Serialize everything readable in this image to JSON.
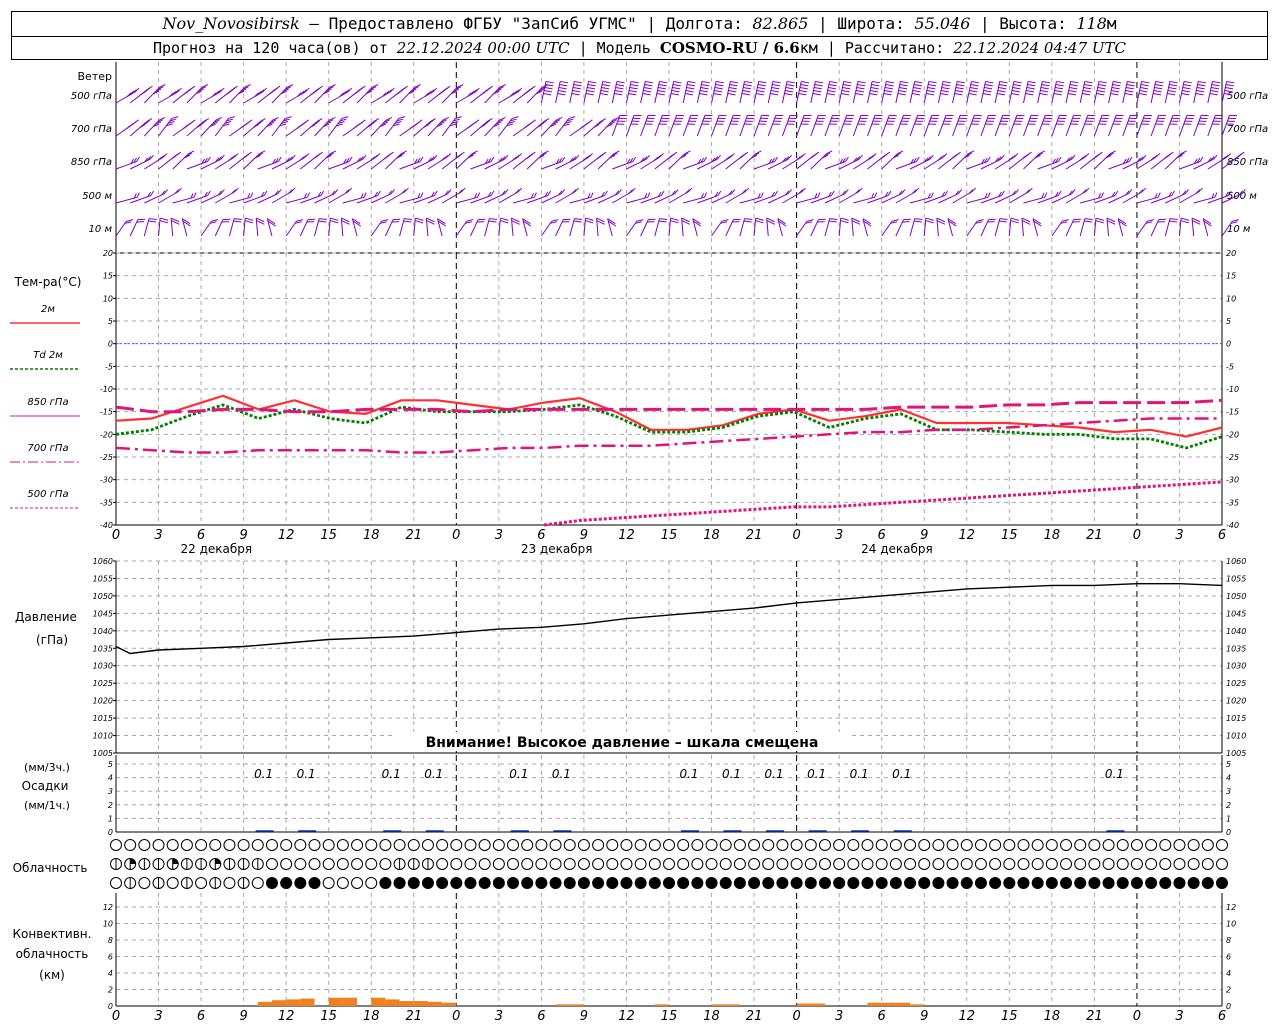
{
  "header": {
    "station": "Nov_Novosibirsk",
    "provided": "– Предоставлено ФГБУ \"ЗапСиб УГМС\" | Долгота:",
    "lon": "82.865",
    "lat_label": "| Широта:",
    "lat": "55.046",
    "alt_label": "| Высота:",
    "alt": "118",
    "alt_unit": "м",
    "forecast_label": "Прогноз на 120 часа(ов) от",
    "forecast_time": "22.12.2024 00:00 UTC",
    "model_label": "| Модель",
    "model": "COSMO-RU / 6.6",
    "model_unit": "км",
    "computed_label": "| Рассчитано:",
    "computed_time": "22.12.2024 04:47 UTC"
  },
  "wind": {
    "title": "Ветер",
    "levels": [
      "500 гПа",
      "700 гПа",
      "850 гПа",
      "500 м",
      "10 м"
    ],
    "color": "#8000c0"
  },
  "temperature": {
    "title": "Тем-ра(°C)",
    "legend": [
      {
        "label": "2м",
        "color": "#ff3030"
      },
      {
        "label": "Td 2м",
        "color": "#008000"
      },
      {
        "label": "850 гПа",
        "color": "#e0147c"
      },
      {
        "label": "700 гПа",
        "color": "#e0147c"
      },
      {
        "label": "500 гПа",
        "color": "#e0147c"
      }
    ],
    "ticks": [
      "20",
      "15",
      "10",
      "5",
      "0",
      "-5",
      "-10",
      "-15",
      "-20",
      "-25",
      "-30",
      "-35",
      "-40"
    ]
  },
  "time_axis": {
    "hour_labels": [
      "0",
      "3",
      "6",
      "9",
      "12",
      "15",
      "18",
      "21",
      "0",
      "3",
      "6",
      "9",
      "12",
      "15",
      "18",
      "21",
      "0",
      "3",
      "6",
      "9",
      "12",
      "15",
      "18",
      "21",
      "0",
      "3",
      "6"
    ],
    "day_labels": [
      "22 декабря",
      "23 декабря",
      "24 декабря"
    ]
  },
  "pressure": {
    "title": "Давление",
    "unit": "(гПа)",
    "ticks": [
      "1060",
      "1055",
      "1050",
      "1045",
      "1040",
      "1035",
      "1030",
      "1025",
      "1020",
      "1015",
      "1010",
      "1005"
    ],
    "warning": "Внимание! Высокое давление – шкала смещена"
  },
  "precip": {
    "label_3h": "(мм/3ч.)",
    "title": "Осадки",
    "label_1h": "(мм/1ч.)",
    "ticks": [
      "5",
      "4",
      "3",
      "2",
      "1",
      "0"
    ],
    "value_labels": [
      {
        "hour": 9,
        "text": "0.1"
      },
      {
        "hour": 12,
        "text": "0.1"
      },
      {
        "hour": 18,
        "text": "0.1"
      },
      {
        "hour": 21,
        "text": "0.1"
      },
      {
        "hour": 27,
        "text": "0.1"
      },
      {
        "hour": 30,
        "text": "0.1"
      },
      {
        "hour": 39,
        "text": "0.1"
      },
      {
        "hour": 42,
        "text": "0.1"
      },
      {
        "hour": 45,
        "text": "0.1"
      },
      {
        "hour": 48,
        "text": "0.1"
      },
      {
        "hour": 51,
        "text": "0.1"
      },
      {
        "hour": 54,
        "text": "0.1"
      },
      {
        "hour": 69,
        "text": "0.1"
      }
    ]
  },
  "cloud": {
    "title": "Облачность"
  },
  "convective": {
    "title_1": "Конвективн.",
    "title_2": "облачность",
    "unit": "(км)",
    "ticks": [
      "12",
      "10",
      "8",
      "6",
      "4",
      "2",
      "0"
    ],
    "color": "#f08020"
  },
  "chart_data": [
    {
      "type": "line",
      "title": "Тем-ра(°C)",
      "ylim": [
        -40,
        20
      ],
      "x_hours": [
        0,
        3,
        6,
        9,
        12,
        15,
        18,
        21,
        24,
        27,
        30,
        33,
        36,
        39,
        42,
        45,
        48,
        51,
        54,
        57,
        60,
        63,
        66,
        69,
        72,
        75,
        78
      ],
      "series": [
        {
          "name": "2м",
          "values": [
            -17,
            -16.5,
            -14,
            -11.5,
            -14.5,
            -12.5,
            -15,
            -15.5,
            -12.5,
            -12.5,
            -13.5,
            -14.5,
            -13,
            -12,
            -15,
            -19,
            -19,
            -18,
            -15.5,
            -14.5,
            -17,
            -16,
            -14.5,
            -17.5,
            -17.5,
            -17.5,
            -18,
            -18.5,
            -19.5,
            -19,
            -20.5,
            -18.5
          ]
        },
        {
          "name": "Td 2м",
          "values": [
            -20,
            -19,
            -16,
            -13.5,
            -16.5,
            -14.5,
            -16.5,
            -17.5,
            -14,
            -15,
            -15,
            -15,
            -14.5,
            -13.5,
            -16,
            -19.5,
            -19.5,
            -18.5,
            -16,
            -15,
            -18.5,
            -16.5,
            -15.5,
            -19,
            -19,
            -19.5,
            -20,
            -20,
            -21,
            -21,
            -23,
            -20.5
          ]
        },
        {
          "name": "850 гПа",
          "values": [
            -14,
            -15,
            -15,
            -14.5,
            -14.5,
            -15,
            -15,
            -14.5,
            -14.5,
            -14.5,
            -15,
            -14.5,
            -14.5,
            -14.5,
            -14.5,
            -14.5,
            -14.5,
            -14.5,
            -14.5,
            -14.5,
            -14.5,
            -14.5,
            -14,
            -14,
            -14,
            -13.5,
            -13.5,
            -13,
            -13,
            -13,
            -13,
            -12.5
          ]
        },
        {
          "name": "700 гПа",
          "values": [
            -23,
            -23.5,
            -24,
            -24,
            -23.5,
            -23.5,
            -23.5,
            -23.5,
            -24,
            -24,
            -23.5,
            -23,
            -23,
            -22.5,
            -22.5,
            -22.5,
            -22,
            -21.5,
            -21,
            -20.5,
            -20,
            -19.5,
            -19.5,
            -19,
            -19,
            -18.5,
            -18,
            -17.5,
            -17,
            -16.5,
            -16.5,
            -16.5
          ]
        },
        {
          "name": "500 гПа",
          "values": [
            null,
            null,
            null,
            null,
            null,
            null,
            null,
            null,
            null,
            null,
            null,
            null,
            -40,
            -39,
            -38.5,
            -38,
            -37.5,
            -37,
            -36.5,
            -36,
            -36,
            -35.5,
            -35,
            -34.5,
            -34,
            -33.5,
            -33,
            -32.5,
            -32,
            -31.5,
            -31,
            -30.5
          ]
        }
      ],
      "series_x_hours": [
        0,
        3,
        6,
        9,
        12,
        15,
        18,
        21,
        24,
        27,
        30,
        33,
        36,
        39,
        42,
        45,
        48,
        51,
        54,
        57,
        60,
        63,
        66,
        69,
        72,
        75,
        78,
        81,
        84,
        87,
        90,
        93
      ]
    },
    {
      "type": "line",
      "title": "Давление",
      "ylabel": "(гПа)",
      "ylim": [
        1005,
        1060
      ],
      "x_hours": [
        0,
        1,
        3,
        6,
        9,
        12,
        15,
        18,
        21,
        24,
        27,
        30,
        33,
        36,
        39,
        42,
        45,
        48,
        51,
        54,
        57,
        60,
        63,
        66,
        69,
        72,
        75,
        78
      ],
      "series": [
        {
          "name": "Давление",
          "values": [
            1035.5,
            1033.5,
            1034.5,
            1035,
            1035.5,
            1036.5,
            1037.5,
            1038,
            1038.5,
            1039.5,
            1040.5,
            1041,
            1042,
            1043.5,
            1044.5,
            1045.5,
            1046.5,
            1048,
            1049,
            1050,
            1051,
            1052,
            1052.5,
            1053,
            1053,
            1053.5,
            1053.5,
            1053
          ]
        }
      ]
    },
    {
      "type": "bar",
      "title": "Конвективн. облачность (км)",
      "ylim": [
        0,
        14
      ],
      "x_hours": [
        10,
        11,
        12,
        13,
        15,
        16,
        18,
        19,
        20,
        21,
        22,
        23,
        31,
        32,
        38,
        42,
        43,
        48,
        49,
        53,
        54,
        55,
        56
      ],
      "series": [
        {
          "name": "Конвективн. облачность",
          "values": [
            0.5,
            0.7,
            0.8,
            0.9,
            1.0,
            1.0,
            1.0,
            0.8,
            0.6,
            0.6,
            0.5,
            0.4,
            0.2,
            0.2,
            0.2,
            0.2,
            0.2,
            0.3,
            0.3,
            0.4,
            0.4,
            0.4,
            0.2
          ]
        }
      ]
    }
  ]
}
